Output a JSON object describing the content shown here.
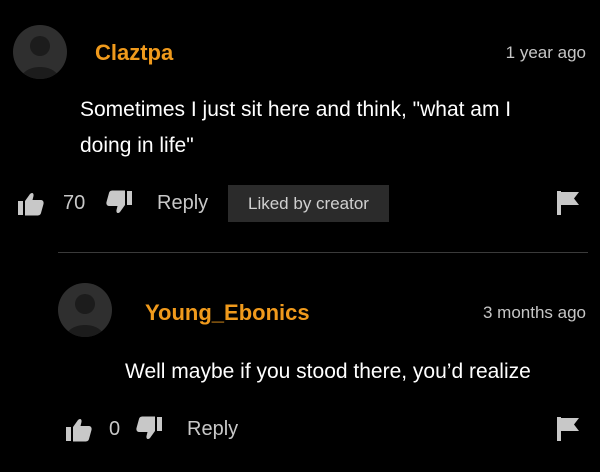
{
  "comments": [
    {
      "username": "Claztpa",
      "timestamp": "1 year ago",
      "text": "Sometimes I just sit here and think, \"what am I doing in life\"",
      "likes": "70",
      "reply_label": "Reply",
      "badge": "Liked by creator",
      "avatar_icon": "user-silhouette-icon",
      "like_icon": "thumbs-up-icon",
      "dislike_icon": "thumbs-down-icon",
      "flag_icon": "flag-icon"
    },
    {
      "username": "Young_Ebonics",
      "timestamp": "3 months ago",
      "text": "Well maybe if you stood there, you’d realize",
      "likes": "0",
      "reply_label": "Reply",
      "avatar_icon": "user-silhouette-icon",
      "like_icon": "thumbs-up-icon",
      "dislike_icon": "thumbs-down-icon",
      "flag_icon": "flag-icon"
    }
  ],
  "colors": {
    "background": "#000000",
    "username": "#f09a1c",
    "text": "#ffffff",
    "muted": "#c6c6c6",
    "badge_bg": "#2b2b2b"
  }
}
